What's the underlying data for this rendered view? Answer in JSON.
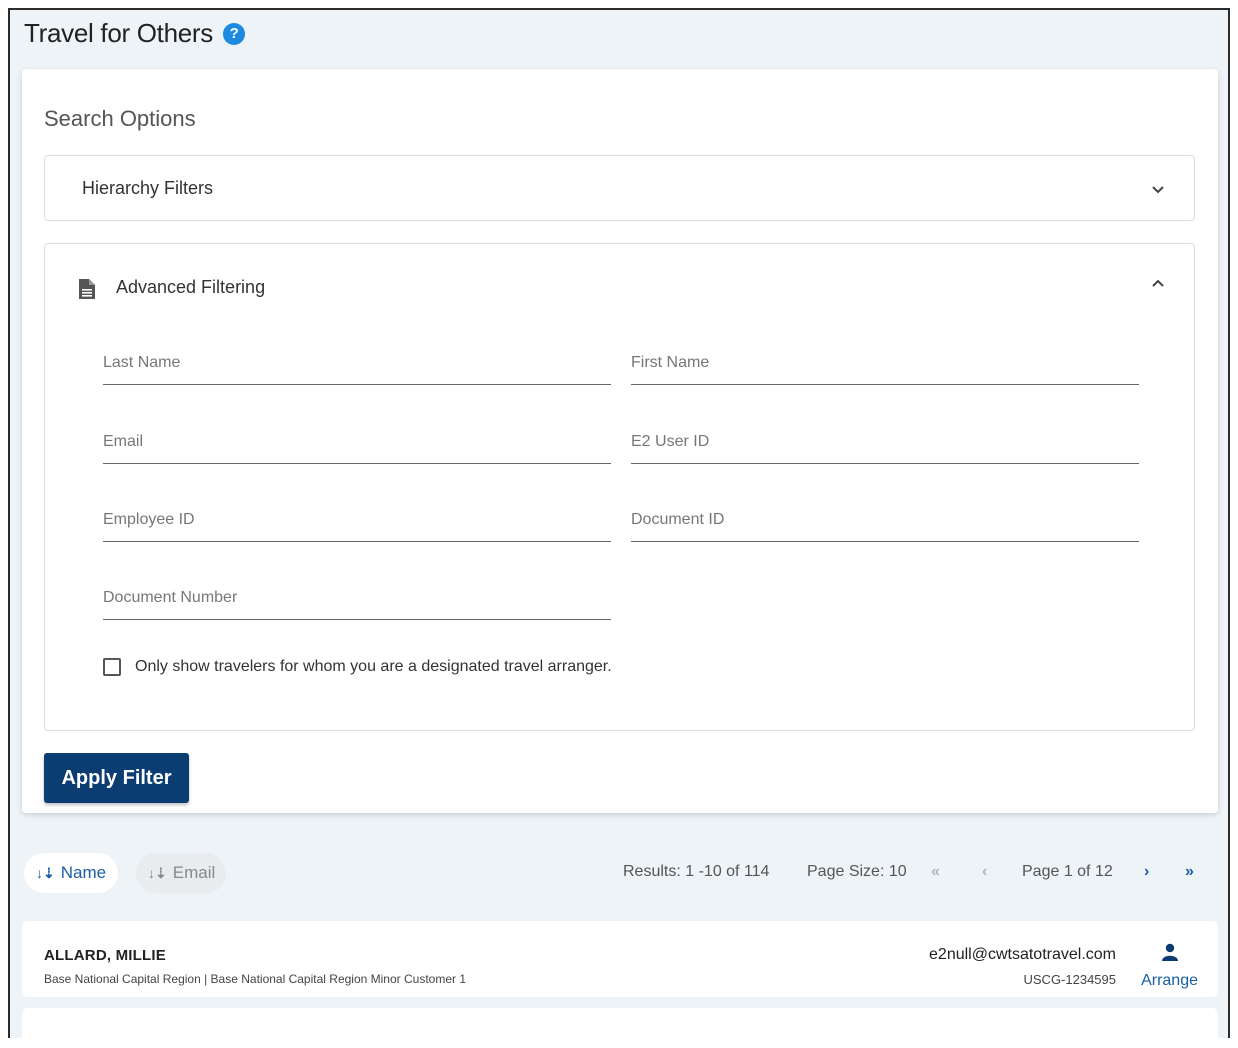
{
  "page": {
    "title": "Travel for Others",
    "help_icon": "?",
    "accent": "#1b8ae0",
    "primary": "#0b3d73"
  },
  "search": {
    "title": "Search Options",
    "hierarchy_label": "Hierarchy Filters",
    "advanced_label": "Advanced Filtering",
    "fields": {
      "last_name": "Last Name",
      "first_name": "First Name",
      "email": "Email",
      "e2_user_id": "E2 User ID",
      "employee_id": "Employee ID",
      "document_id": "Document ID",
      "document_number": "Document Number"
    },
    "checkbox_label": "Only show travelers for whom you are a designated travel arranger.",
    "apply_label": "Apply Filter"
  },
  "sort": {
    "name_label": "Name",
    "email_label": "Email",
    "sort_glyph": "↓⇣"
  },
  "pager": {
    "results": "Results: 1 -10 of 114",
    "page_size": "Page Size: 10",
    "page": "Page 1 of 12",
    "first": "«",
    "prev": "‹",
    "next": "›",
    "last": "»"
  },
  "results": [
    {
      "name": "ALLARD, MILLIE",
      "org": "Base National Capital Region | Base National Capital Region Minor Customer 1",
      "email": "e2null@cwtsatotravel.com",
      "id": "USCG-1234595",
      "action": "Arrange"
    }
  ]
}
